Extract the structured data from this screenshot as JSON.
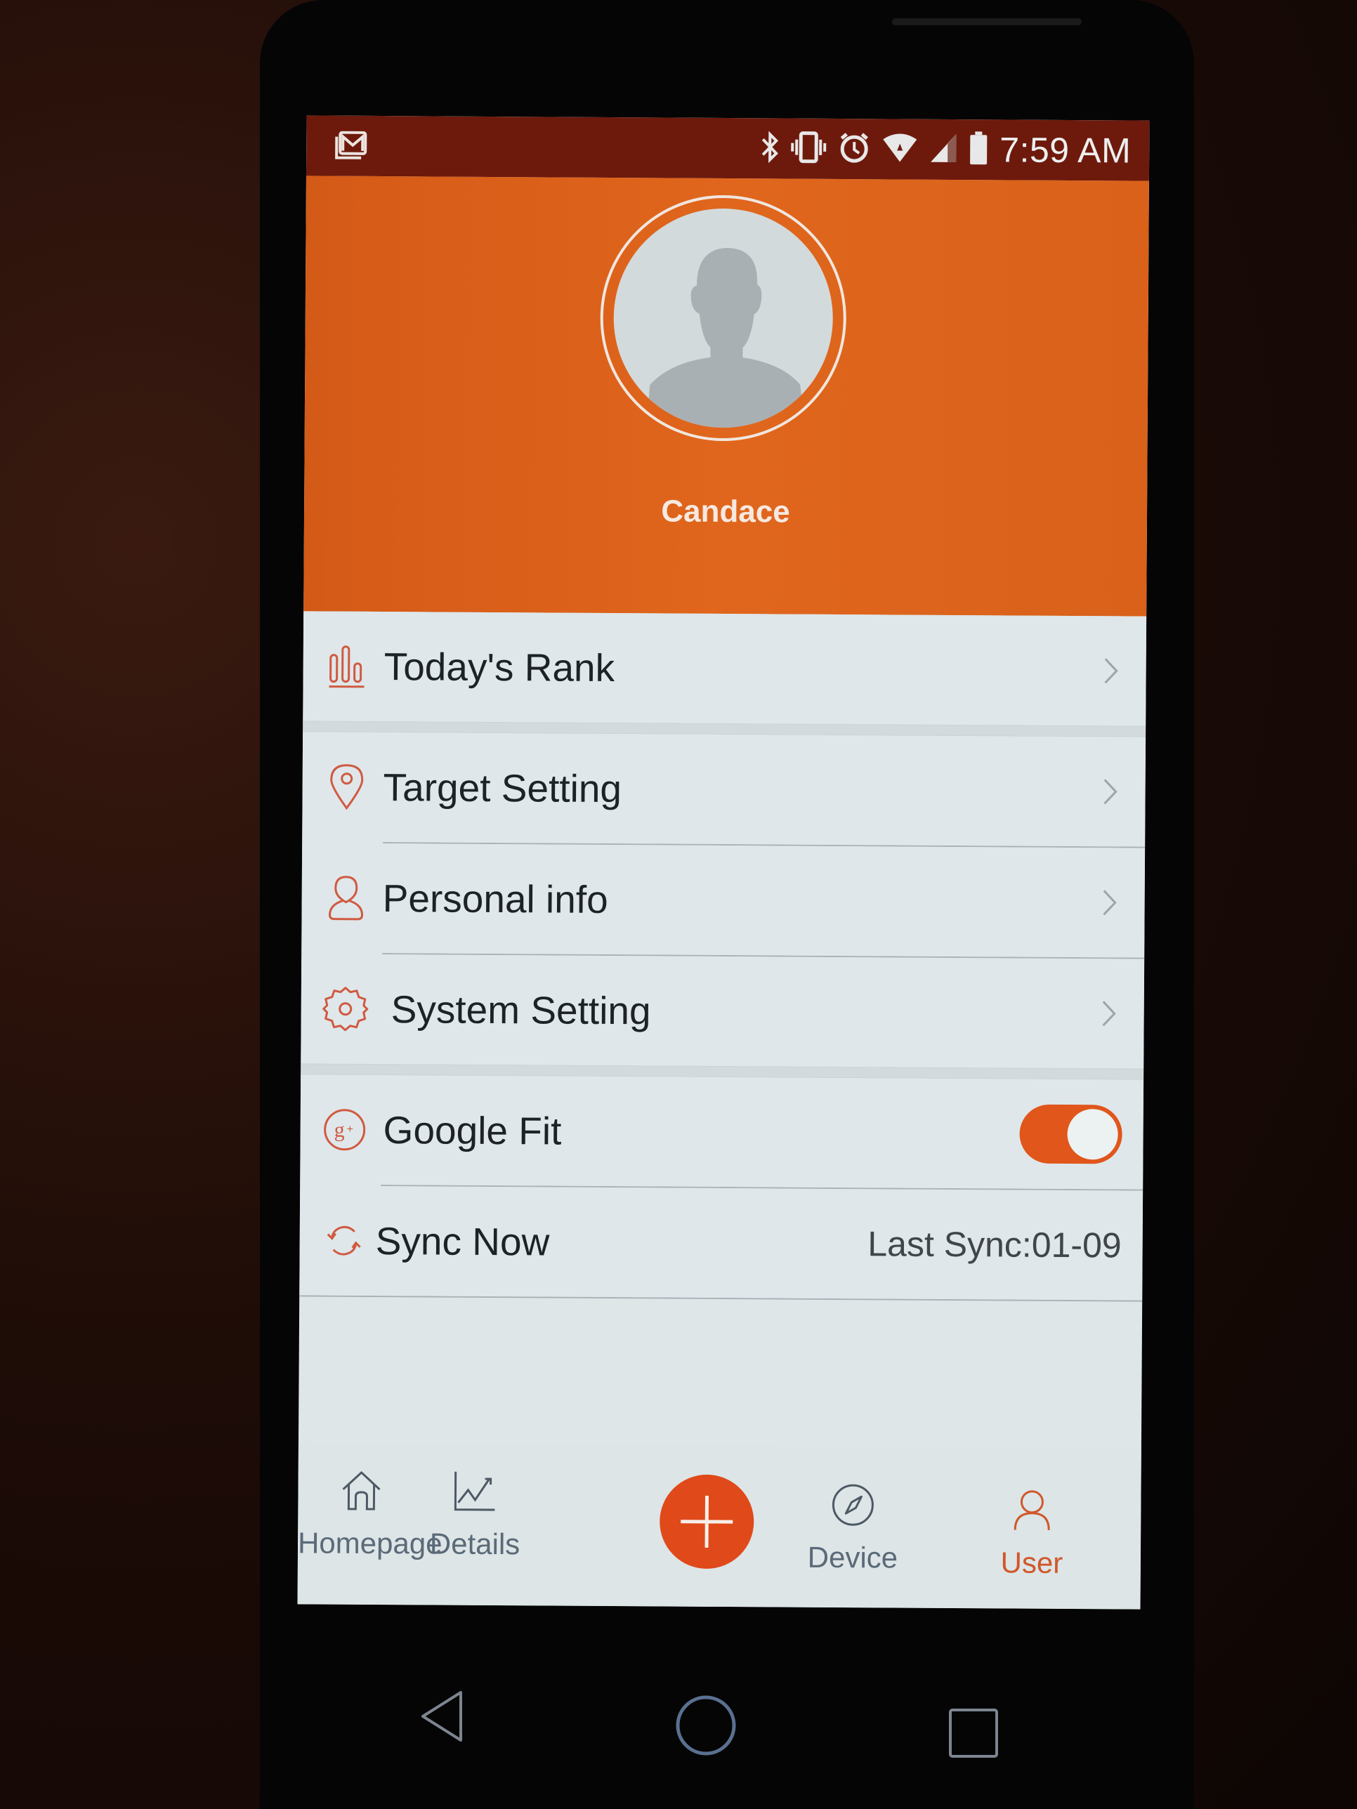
{
  "status_bar": {
    "notification_icon": "gmail-icon",
    "icons": [
      "bluetooth-icon",
      "vibrate-icon",
      "alarm-icon",
      "wifi-icon",
      "signal-icon",
      "battery-icon"
    ],
    "time": "7:59 AM"
  },
  "profile": {
    "avatar": "default-avatar-silhouette",
    "name": "Candace"
  },
  "menu": [
    {
      "id": "todays-rank",
      "label": "Today's Rank",
      "icon": "bar-chart-icon",
      "trailing": "chevron"
    },
    {
      "id": "target-setting",
      "label": "Target Setting",
      "icon": "location-pin-icon",
      "trailing": "chevron"
    },
    {
      "id": "personal-info",
      "label": "Personal info",
      "icon": "person-icon",
      "trailing": "chevron"
    },
    {
      "id": "system-setting",
      "label": "System Setting",
      "icon": "gear-icon",
      "trailing": "chevron"
    },
    {
      "id": "google-fit",
      "label": "Google Fit",
      "icon": "google-plus-icon",
      "trailing": "toggle",
      "toggle_on": true
    },
    {
      "id": "sync-now",
      "label": "Sync Now",
      "icon": "sync-icon",
      "trailing": "text",
      "trailing_text": "Last Sync:01-09"
    }
  ],
  "tabbar": {
    "tabs": [
      {
        "label": "Homepage",
        "icon": "home-icon",
        "active": false
      },
      {
        "label": "Details",
        "icon": "line-chart-icon",
        "active": false
      },
      {
        "label": "",
        "icon": "plus-icon",
        "active": false
      },
      {
        "label": "Device",
        "icon": "compass-icon",
        "active": false
      },
      {
        "label": "User",
        "icon": "user-icon",
        "active": true
      }
    ]
  },
  "system_nav": [
    "back-icon",
    "home-circle-icon",
    "recents-icon"
  ],
  "colors": {
    "accent": "#e0561b",
    "status_bar": "#6d1a0d",
    "header": "#dd631c",
    "list_bg": "#dfe7ea",
    "inactive_tab": "#5b6a78",
    "active_tab": "#d0582a"
  }
}
